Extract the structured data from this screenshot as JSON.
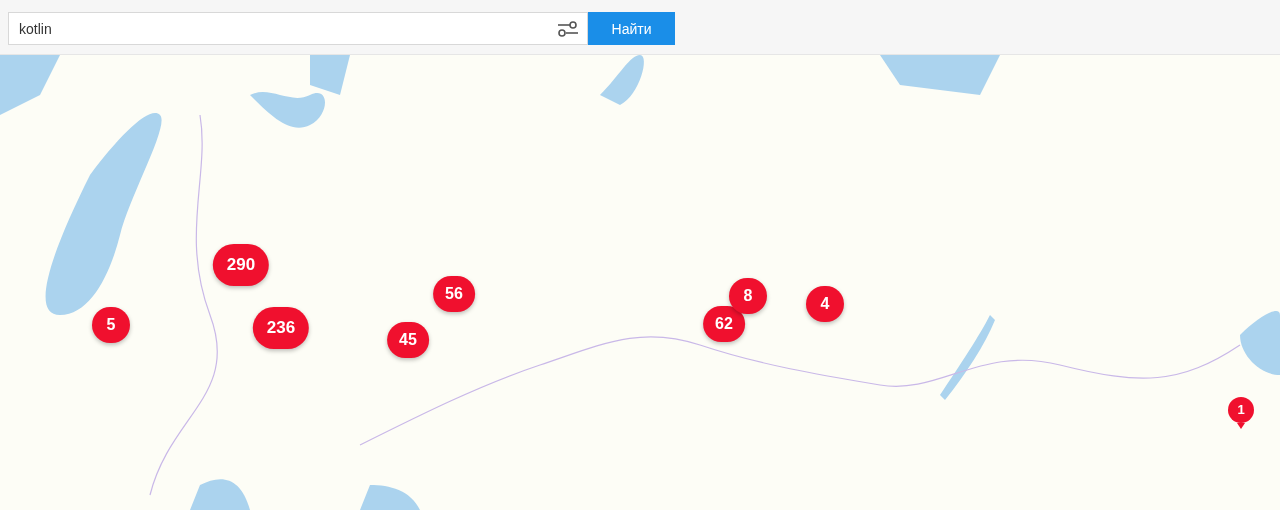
{
  "search": {
    "value": "kotlin",
    "button": "Найти"
  },
  "markers": [
    {
      "kind": "cluster",
      "count": "5"
    },
    {
      "kind": "cluster",
      "count": "290"
    },
    {
      "kind": "cluster",
      "count": "236"
    },
    {
      "kind": "cluster",
      "count": "45"
    },
    {
      "kind": "cluster",
      "count": "56"
    },
    {
      "kind": "cluster",
      "count": "62"
    },
    {
      "kind": "cluster",
      "count": "8"
    },
    {
      "kind": "cluster",
      "count": "4"
    },
    {
      "kind": "pin",
      "count": "1"
    }
  ]
}
